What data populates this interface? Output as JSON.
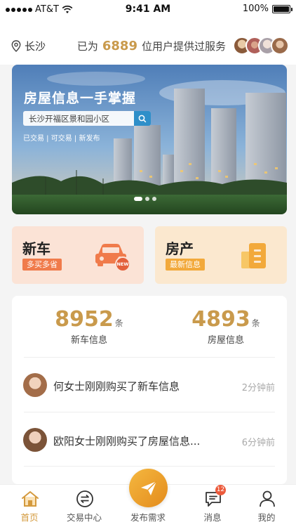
{
  "status_bar": {
    "carrier": "AT&T",
    "time": "9:41 AM",
    "battery": "100%"
  },
  "header": {
    "location": "长沙",
    "serve_prefix": "已为",
    "serve_count": "6889",
    "serve_suffix": "位用户提供过服务"
  },
  "banner": {
    "title": "房屋信息一手掌握",
    "search_value": "长沙开福区景和园小区",
    "tags": "已交易 | 可交易 | 新发布"
  },
  "categories": [
    {
      "title": "新车",
      "badge": "多买多省",
      "icon": "car-icon",
      "icon_badge": "NEW"
    },
    {
      "title": "房产",
      "badge": "最新信息",
      "icon": "building-icon"
    }
  ],
  "stats": [
    {
      "number": "8952",
      "unit": "条",
      "label": "新车信息"
    },
    {
      "number": "4893",
      "unit": "条",
      "label": "房屋信息"
    }
  ],
  "feed": [
    {
      "text": "何女士刚刚购买了新车信息",
      "time": "2分钟前"
    },
    {
      "text": "欧阳女士刚刚购买了房屋信息...",
      "time": "6分钟前"
    }
  ],
  "tabbar": {
    "items": [
      {
        "label": "首页",
        "icon": "home-icon",
        "active": true
      },
      {
        "label": "交易中心",
        "icon": "exchange-icon"
      },
      {
        "label": "发布需求",
        "icon": "send-icon"
      },
      {
        "label": "消息",
        "icon": "message-icon",
        "badge": "12"
      },
      {
        "label": "我的",
        "icon": "user-icon"
      }
    ]
  },
  "colors": {
    "accent": "#d49a3e",
    "gold": "#c99a4c",
    "orange": "#f07b4b",
    "car_card": "#fbe3d6",
    "house_card": "#fbe8cf"
  }
}
